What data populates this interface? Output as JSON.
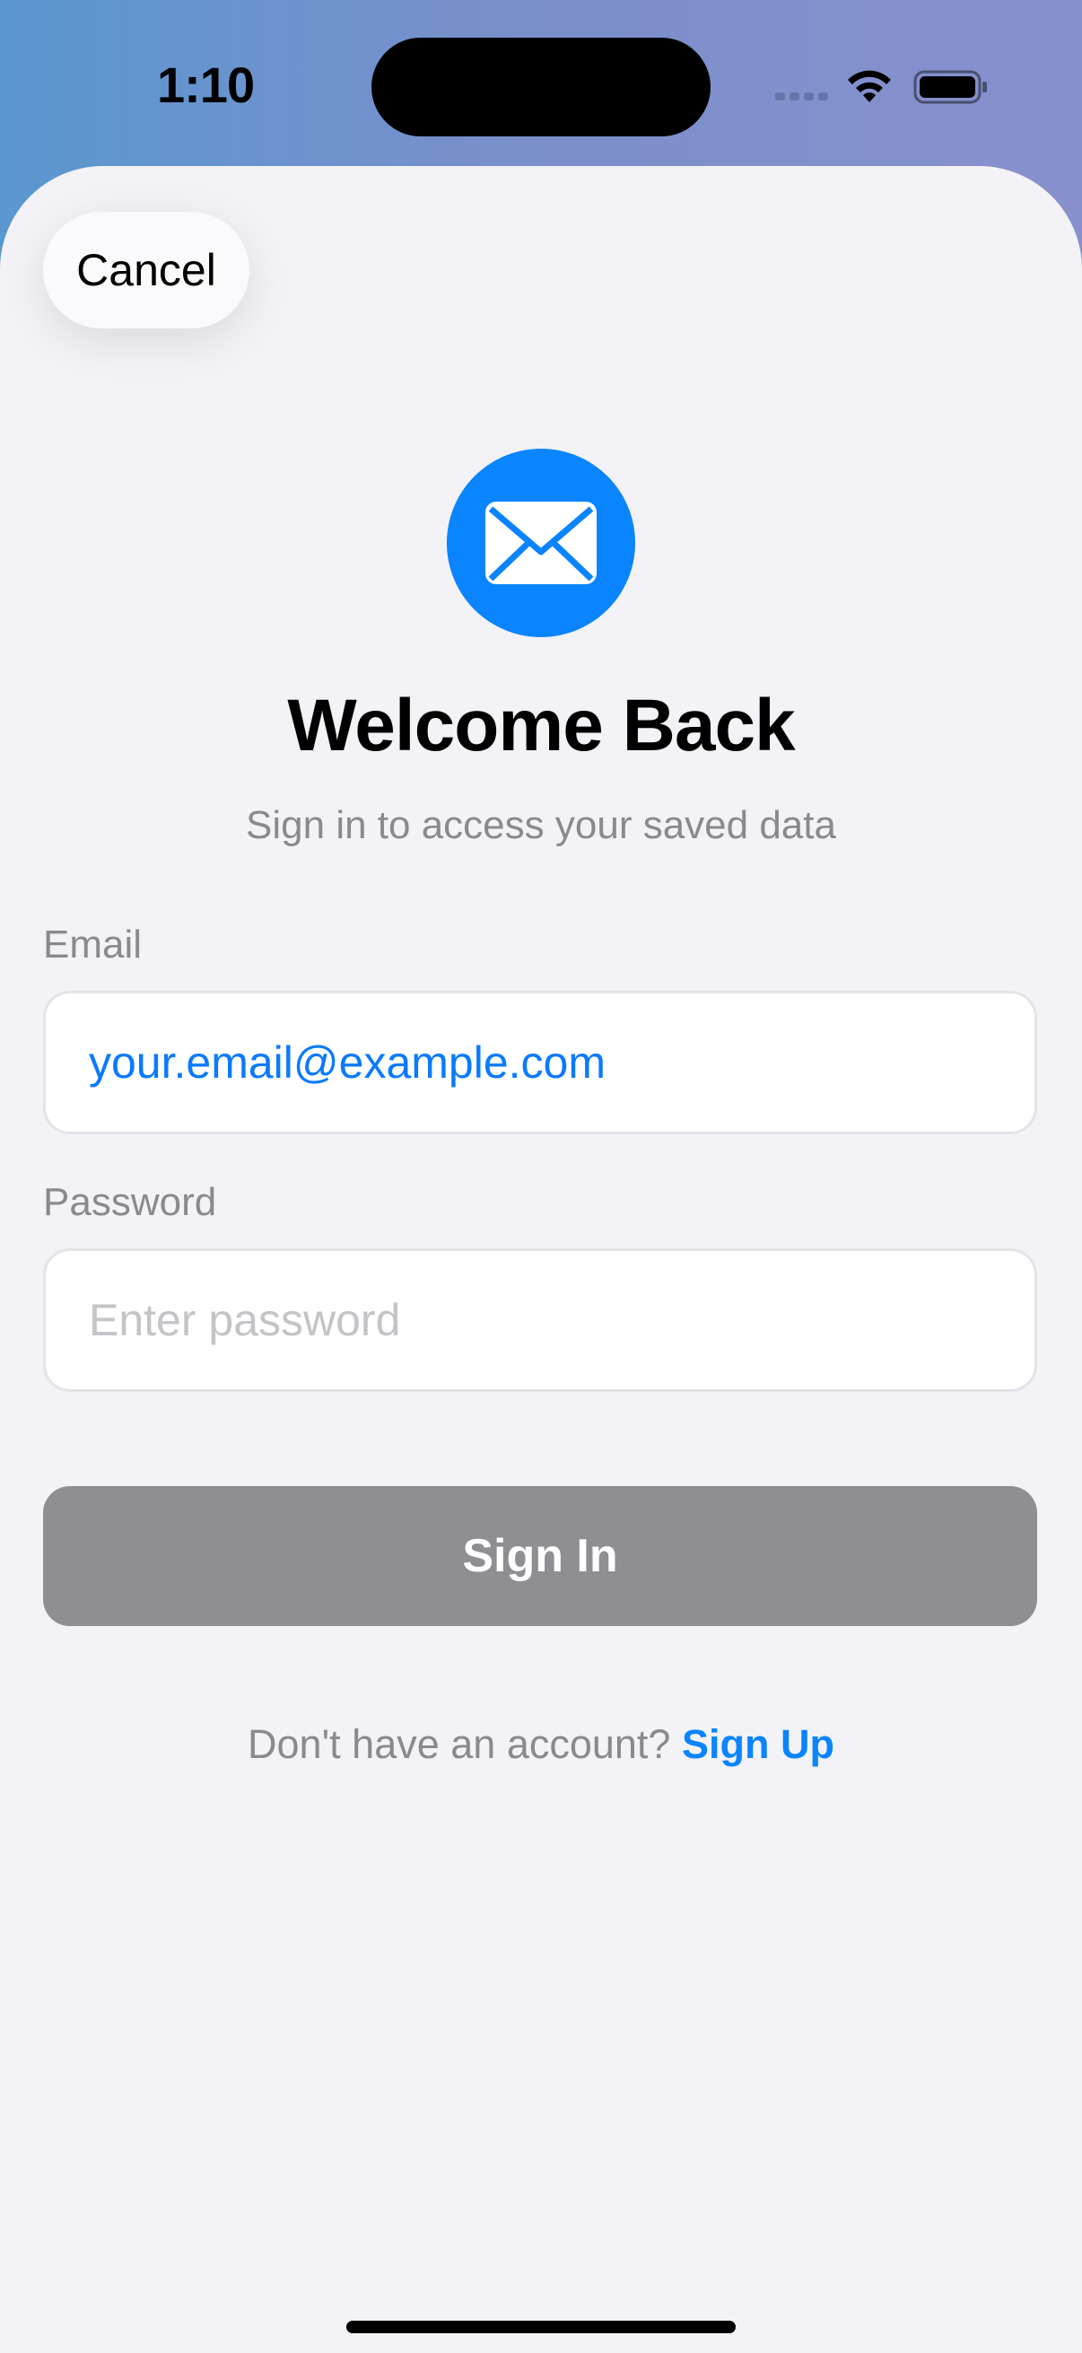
{
  "status_bar": {
    "time": "1:10"
  },
  "toolbar": {
    "cancel_label": "Cancel"
  },
  "header": {
    "icon": "envelope-icon",
    "title": "Welcome Back",
    "subtitle": "Sign in to access your saved data"
  },
  "form": {
    "email_label": "Email",
    "email_value": "your.email@example.com",
    "password_label": "Password",
    "password_placeholder": "Enter password",
    "submit_label": "Sign In"
  },
  "footer": {
    "prompt": "Don't have an account?",
    "signup_label": "Sign Up"
  },
  "colors": {
    "accent": "#0a84ff",
    "disabled_button": "#8e8e93",
    "background": "#f2f2f7"
  }
}
